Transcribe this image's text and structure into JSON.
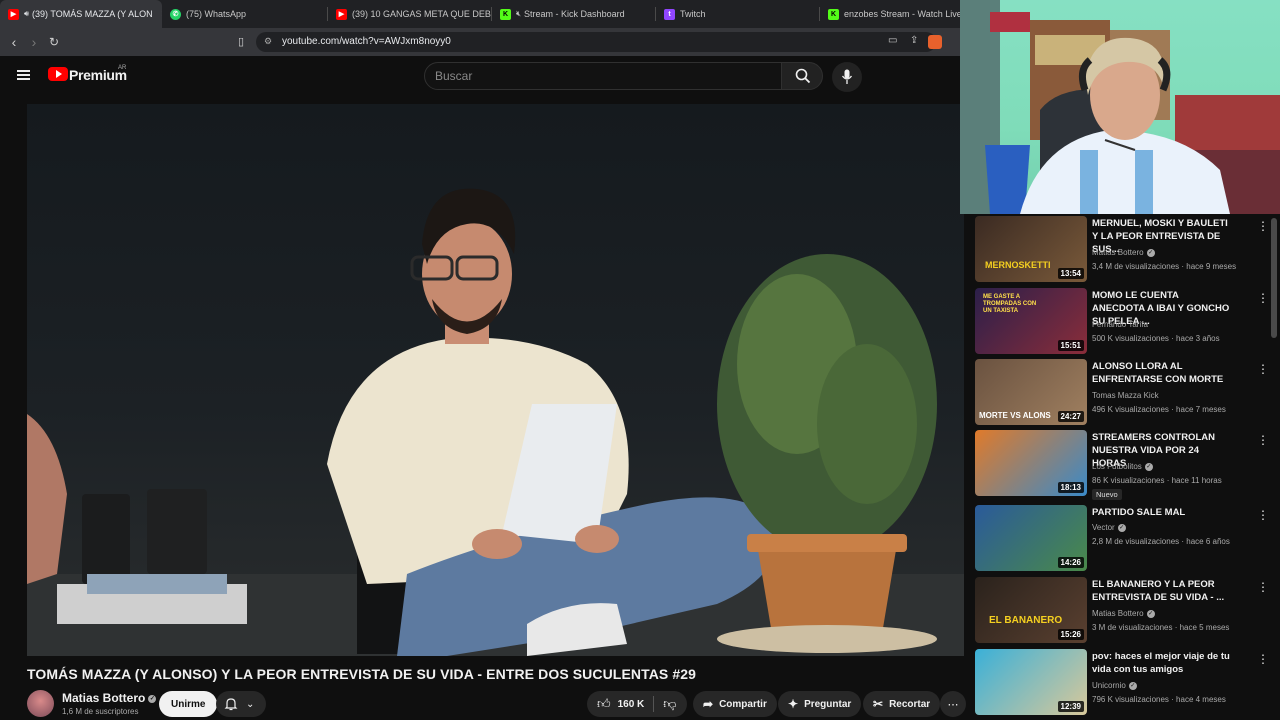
{
  "browser": {
    "tabs": [
      {
        "label": "(39) TOMÁS MAZZA (Y ALON",
        "color": "#ff0000",
        "active": true
      },
      {
        "label": "(75) WhatsApp",
        "color": "#25d366"
      },
      {
        "label": "(39) 10 GANGAS META QUE DEBES F",
        "color": "#ff0000"
      },
      {
        "label": "Stream - Kick Dashboard",
        "color": "#53fc18"
      },
      {
        "label": "Twitch",
        "color": "#9146ff"
      },
      {
        "label": "enzobes Stream - Watch Live on",
        "color": "#53fc18"
      }
    ],
    "url": "youtube.com/watch?v=AWJxm8noyy0"
  },
  "youtube": {
    "logo_text": "Premium",
    "region": "AR",
    "search_placeholder": "Buscar"
  },
  "video": {
    "title": "TOMÁS MAZZA (Y ALONSO) Y LA PEOR ENTREVISTA DE SU VIDA - ENTRE DOS SUCULENTAS #29",
    "channel": "Matias Bottero",
    "subscribers": "1,6 M de suscriptores",
    "join_label": "Unirme",
    "likes": "160 K",
    "share_label": "Compartir",
    "ask_label": "Preguntar",
    "clip_label": "Recortar"
  },
  "recommendations": [
    {
      "title": "MERNUEL, MOSKI Y BAULETI Y LA PEOR ENTREVISTA DE SUS...",
      "channel": "Matias Bottero",
      "verified": true,
      "meta": "3,4 M de visualizaciones · hace 9 meses",
      "duration": "13:54",
      "thumb_text": "MERNOSKETTI",
      "colors": [
        "#3a2a22",
        "#7a5a3a"
      ]
    },
    {
      "title": "MOMO LE CUENTA ANECDOTA A IBAI Y GONCHO SU PELEA ...",
      "channel": "Fernando Tarifa",
      "verified": false,
      "meta": "500 K visualizaciones · hace 3 años",
      "duration": "15:51",
      "thumb_text": "ME GASTE A TROMPADAS CON UN TAXISTA",
      "colors": [
        "#2b1f4a",
        "#8a2d3a"
      ]
    },
    {
      "title": "ALONSO LLORA AL ENFRENTARSE CON MORTE",
      "channel": "Tomas Mazza Kick",
      "verified": false,
      "meta": "496 K visualizaciones · hace 7 meses",
      "duration": "24:27",
      "thumb_text": "MORTE VS ALONS",
      "colors": [
        "#6a5240",
        "#a08060"
      ]
    },
    {
      "title": "STREAMERS CONTROLAN NUESTRA VIDA POR 24 HORAS",
      "channel": "Los Futbolitos",
      "verified": true,
      "meta": "86 K visualizaciones · hace 11 horas",
      "badge": "Nuevo",
      "duration": "18:13",
      "thumb_text": "",
      "colors": [
        "#e07a2a",
        "#3a8ac8"
      ]
    },
    {
      "title": "PARTIDO SALE MAL",
      "channel": "Vector",
      "verified": true,
      "meta": "2,8 M de visualizaciones · hace 6 años",
      "duration": "14:26",
      "thumb_text": "",
      "colors": [
        "#2a5a9a",
        "#4a8a4a"
      ]
    },
    {
      "title": "EL BANANERO Y LA PEOR ENTREVISTA DE SU VIDA - ...",
      "channel": "Matias Bottero",
      "verified": true,
      "meta": "3 M de visualizaciones · hace 5 meses",
      "duration": "15:26",
      "thumb_text": "EL BANANERO",
      "colors": [
        "#2a221c",
        "#5a4030"
      ]
    },
    {
      "title": "pov: haces el mejor viaje de tu vida con tus amigos",
      "channel": "Unicornio",
      "verified": true,
      "meta": "796 K visualizaciones · hace 4 meses",
      "duration": "12:39",
      "thumb_text": "",
      "colors": [
        "#3ab0d8",
        "#d8c89a"
      ]
    }
  ]
}
